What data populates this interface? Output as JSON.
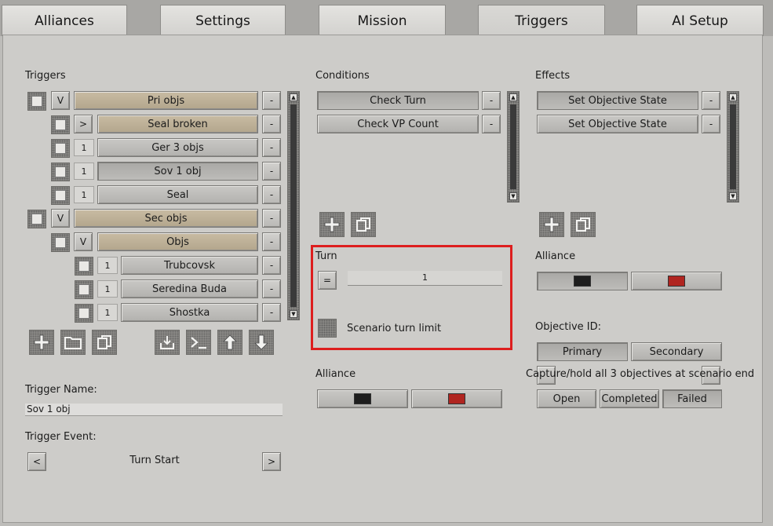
{
  "tabs": [
    {
      "label": "Alliances"
    },
    {
      "label": "Settings"
    },
    {
      "label": "Mission"
    },
    {
      "label": "Triggers",
      "active": true
    },
    {
      "label": "AI Setup"
    }
  ],
  "triggers": {
    "heading": "Triggers",
    "rows": [
      {
        "toggle": "V",
        "label": "Pri objs",
        "style": "gold"
      },
      {
        "toggle": ">",
        "label": "Seal broken",
        "style": "gold"
      },
      {
        "toggle": "1",
        "label": "Ger 3 objs",
        "style": "plain"
      },
      {
        "toggle": "1",
        "label": "Sov 1 obj",
        "style": "selected"
      },
      {
        "toggle": "1",
        "label": "Seal",
        "style": "plain"
      },
      {
        "toggle": "V",
        "label": "Sec objs",
        "style": "gold"
      },
      {
        "toggle": "V",
        "label": "Objs",
        "style": "gold"
      },
      {
        "toggle": "1",
        "label": "Trubcovsk",
        "style": "plain"
      },
      {
        "toggle": "1",
        "label": "Seredina Buda",
        "style": "plain"
      },
      {
        "toggle": "1",
        "label": "Shostka",
        "style": "plain"
      }
    ],
    "remove_label": "-",
    "toolbar_icons": [
      "add-icon",
      "folder-icon",
      "copy-icon",
      "import-icon",
      "console-icon",
      "move-up-icon",
      "move-down-icon"
    ],
    "name_label": "Trigger Name:",
    "name_value": "Sov 1 obj",
    "event_label": "Trigger Event:",
    "event_value": "Turn Start",
    "prev_label": "<",
    "next_label": ">"
  },
  "conditions": {
    "heading": "Conditions",
    "items": [
      "Check Turn",
      "Check VP Count"
    ],
    "remove_label": "-",
    "turn_heading": "Turn",
    "operator": "=",
    "turn_value": "1",
    "limit_label": "Scenario turn limit",
    "alliance_heading": "Alliance",
    "alliance_colors": [
      "#1e1e1e",
      "#b02520"
    ]
  },
  "effects": {
    "heading": "Effects",
    "items": [
      "Set Objective State",
      "Set Objective State"
    ],
    "remove_label": "-",
    "alliance_heading": "Alliance",
    "alliance_colors": [
      "#1e1e1e",
      "#b02520"
    ],
    "objective_heading": "Objective ID:",
    "objective_types": [
      "Primary",
      "Secondary"
    ],
    "objective_text": "Capture/hold all 3 objectives at scenario end",
    "states": [
      "Open",
      "Completed",
      "Failed"
    ]
  },
  "colors": {
    "highlight": "#dd1e1e",
    "gold_bar": "#bdb096"
  }
}
